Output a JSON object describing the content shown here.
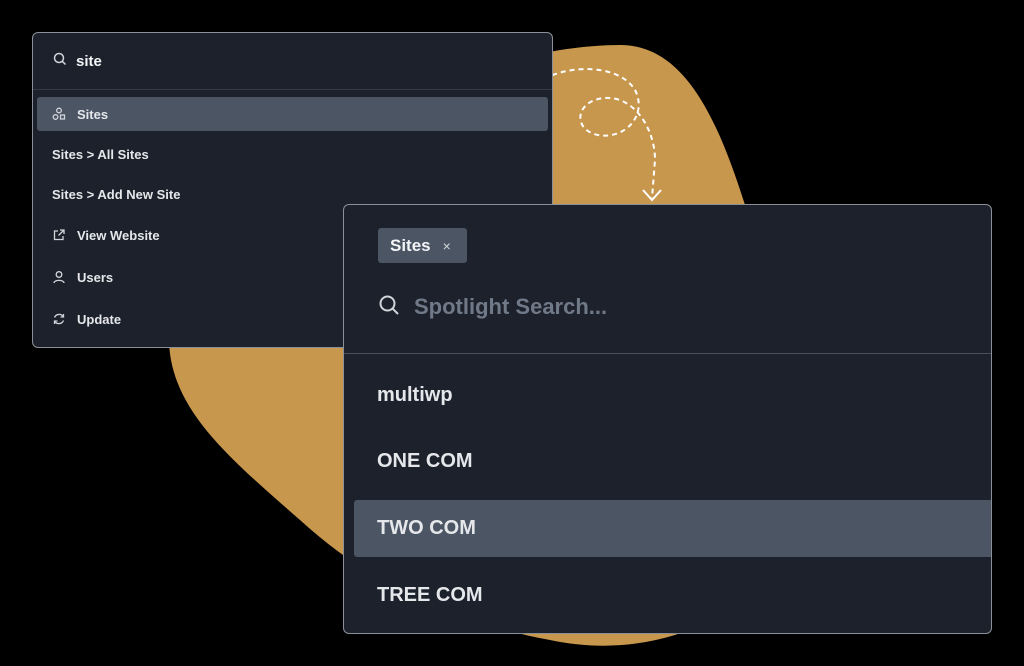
{
  "colors": {
    "blob": "#c8974e",
    "panel_bg": "#1d212b",
    "active_bg": "#4b5563",
    "arrow": "#ffffff"
  },
  "small_palette": {
    "query": "site",
    "search_icon": "search-icon",
    "items": [
      {
        "label": "Sites",
        "icon": "sites-icon",
        "active": true
      },
      {
        "label": "Sites > All Sites",
        "icon": null,
        "active": false
      },
      {
        "label": "Sites > Add New Site",
        "icon": null,
        "active": false
      },
      {
        "label": "View Website",
        "icon": "external-link-icon",
        "active": false
      },
      {
        "label": "Users",
        "icon": "user-icon",
        "active": false
      },
      {
        "label": "Update",
        "icon": "refresh-icon",
        "active": false
      }
    ]
  },
  "large_palette": {
    "chip": {
      "label": "Sites",
      "close": "×"
    },
    "search": {
      "placeholder": "Spotlight Search..."
    },
    "results": [
      {
        "label": "multiwp",
        "active": false
      },
      {
        "label": "ONE COM",
        "active": false
      },
      {
        "label": "TWO COM",
        "active": true
      },
      {
        "label": "TREE COM",
        "active": false
      }
    ]
  }
}
